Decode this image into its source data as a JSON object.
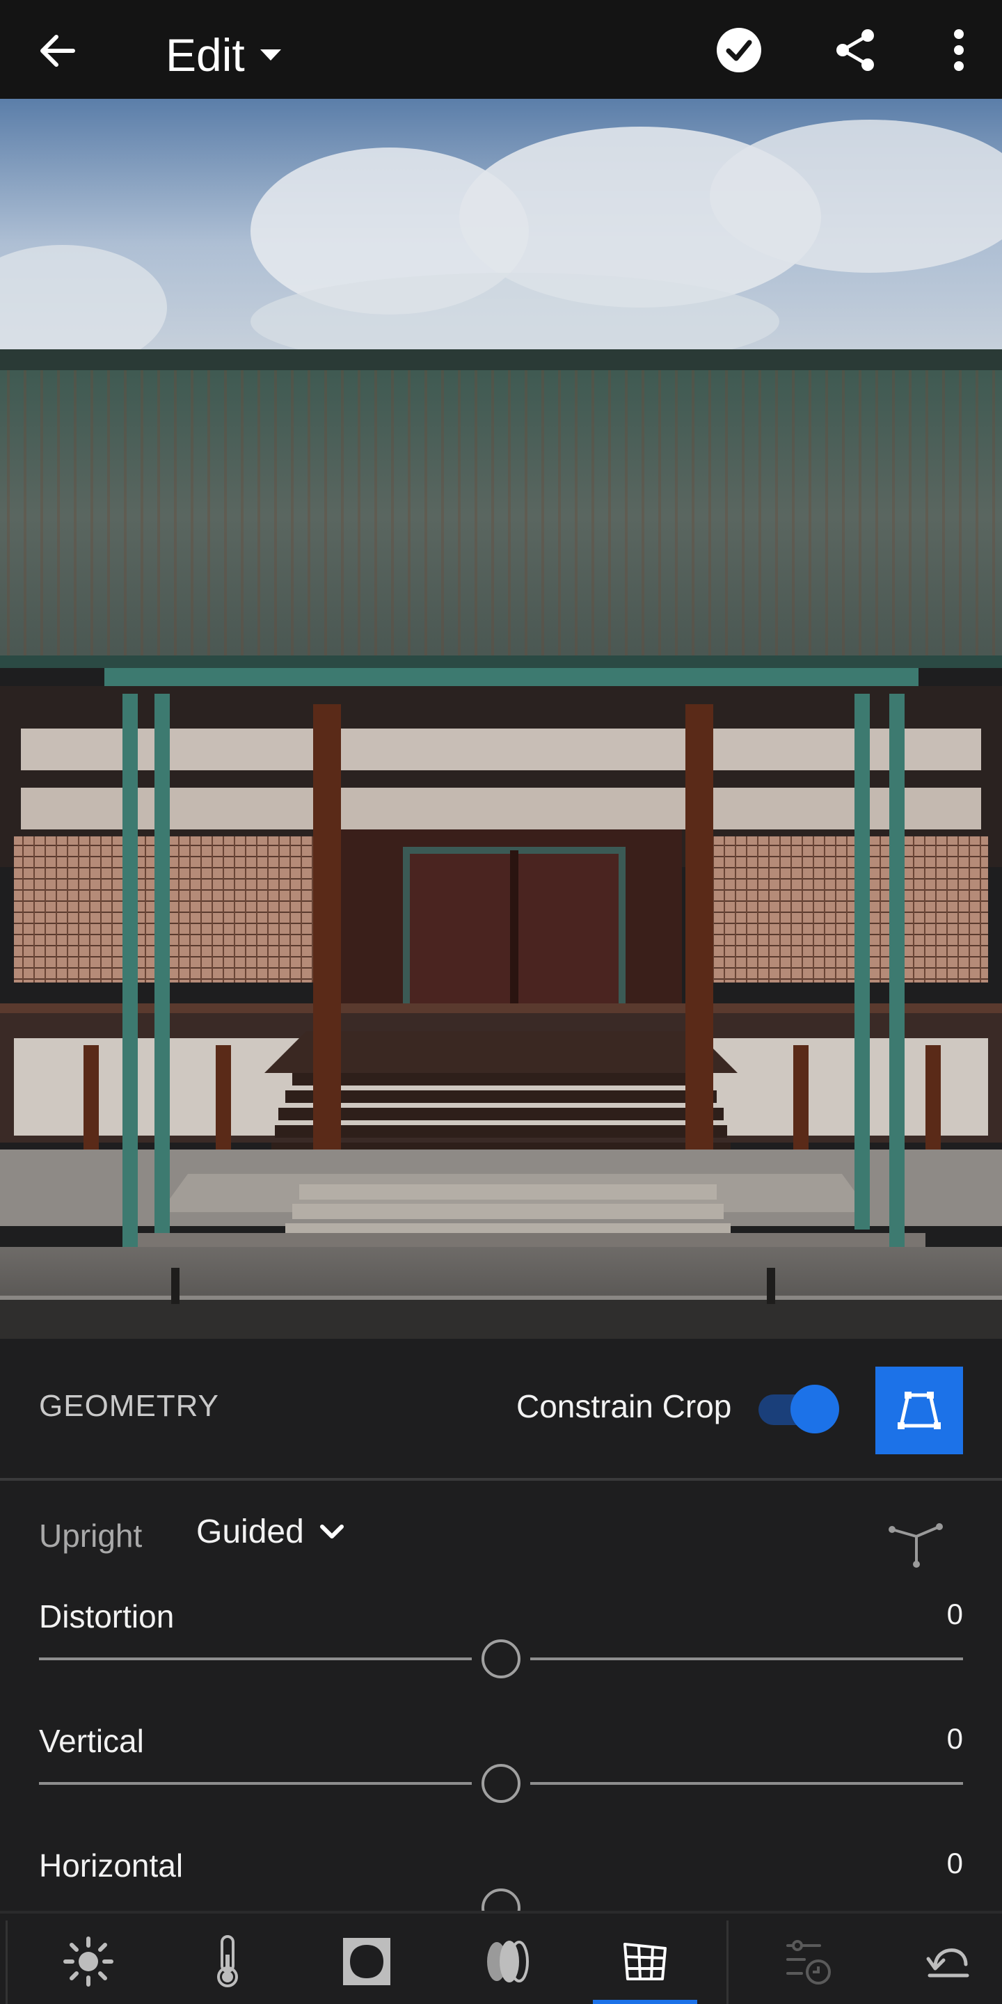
{
  "topbar": {
    "title": "Edit",
    "icons": [
      "back-arrow-icon",
      "dropdown-caret-icon",
      "checkmark-circle-icon",
      "share-icon",
      "more-vertical-icon"
    ]
  },
  "photo": {
    "subject": "photo"
  },
  "panel": {
    "section_title": "GEOMETRY",
    "constrain_crop_label": "Constrain Crop",
    "constrain_crop_on": true,
    "upright_label": "Upright",
    "upright_value": "Guided",
    "sliders": [
      {
        "label": "Distortion",
        "value": "0"
      },
      {
        "label": "Vertical",
        "value": "0"
      },
      {
        "label": "Horizontal",
        "value": "0"
      }
    ]
  },
  "bottombar": {
    "tools": [
      "light-icon",
      "color-icon",
      "effects-icon",
      "optics-icon",
      "geometry-icon",
      "presets-icon",
      "undo-icon"
    ],
    "active_tool": "geometry-icon"
  },
  "colors": {
    "accent": "#1c72e8",
    "background": "#1e1e1f",
    "topbar": "#141414"
  }
}
